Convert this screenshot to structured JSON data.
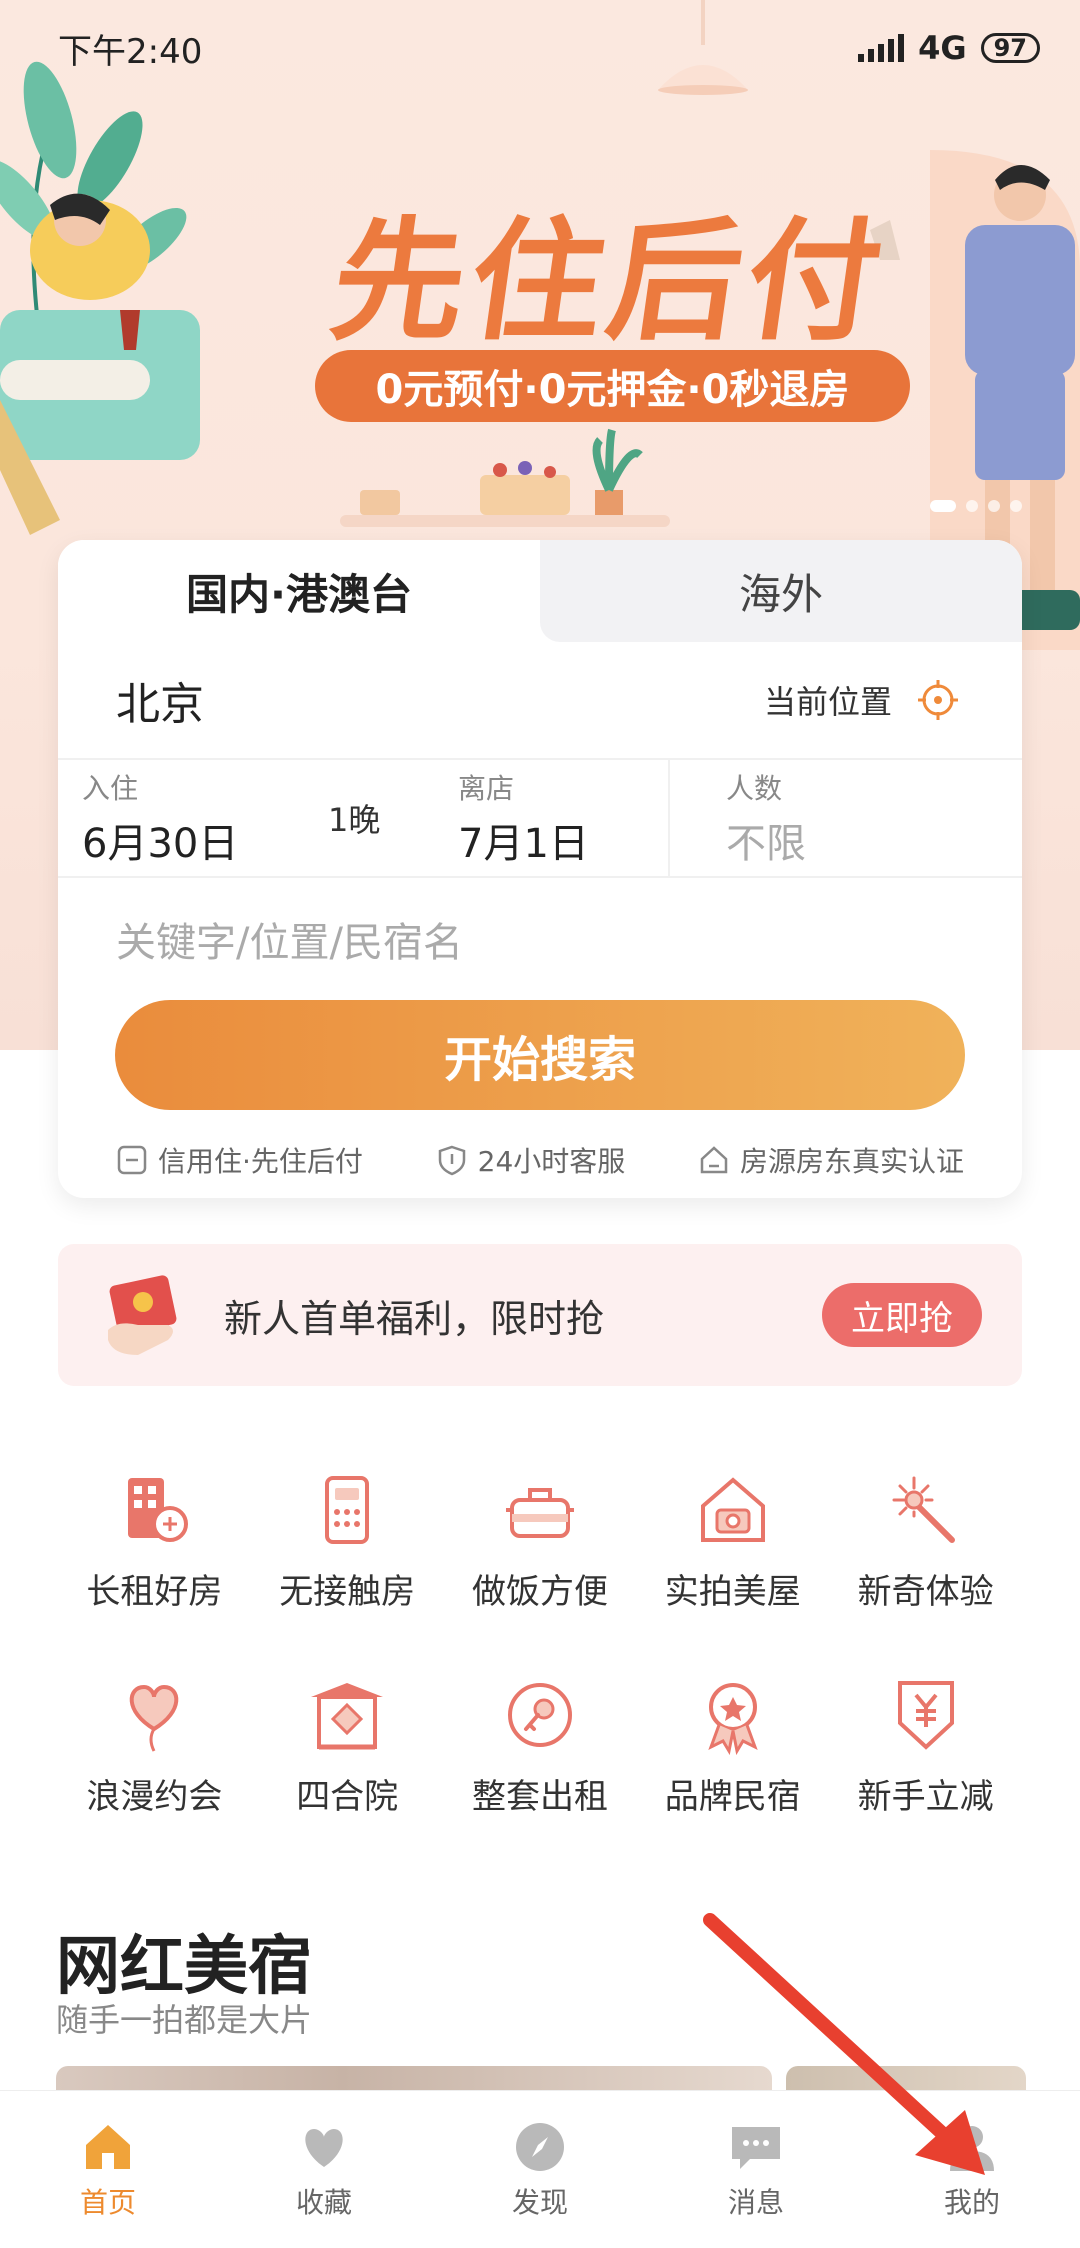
{
  "status_bar": {
    "time": "下午2:40",
    "network": "4G",
    "battery": "97"
  },
  "banner": {
    "title": "先住后付",
    "subtitle": "0元预付·0元押金·0秒退房"
  },
  "search": {
    "tabs": [
      "国内·港澳台",
      "海外"
    ],
    "city": "北京",
    "locate_label": "当前位置",
    "checkin_label": "入住",
    "checkin_date": "6月30日",
    "nights": "1晚",
    "checkout_label": "离店",
    "checkout_date": "7月1日",
    "people_label": "人数",
    "people_value": "不限",
    "keyword_placeholder": "关键字/位置/民宿名",
    "button": "开始搜索",
    "features": [
      "信用住·先住后付",
      "24小时客服",
      "房源房东真实认证"
    ]
  },
  "promo": {
    "text": "新人首单福利，限时抢",
    "button": "立即抢"
  },
  "categories": [
    {
      "label": "长租好房",
      "icon": "building-rent-icon"
    },
    {
      "label": "无接触房",
      "icon": "keypad-door-icon"
    },
    {
      "label": "做饭方便",
      "icon": "cooking-pot-icon"
    },
    {
      "label": "实拍美屋",
      "icon": "house-camera-icon"
    },
    {
      "label": "新奇体验",
      "icon": "magic-wand-icon"
    },
    {
      "label": "浪漫约会",
      "icon": "heart-balloon-icon"
    },
    {
      "label": "四合院",
      "icon": "courtyard-gate-icon"
    },
    {
      "label": "整套出租",
      "icon": "key-circle-icon"
    },
    {
      "label": "品牌民宿",
      "icon": "award-badge-icon"
    },
    {
      "label": "新手立减",
      "icon": "yen-coupon-icon"
    }
  ],
  "section": {
    "title": "网红美宿",
    "subtitle": "随手一拍都是大片"
  },
  "nav": [
    {
      "label": "首页",
      "icon": "home-icon"
    },
    {
      "label": "收藏",
      "icon": "heart-icon"
    },
    {
      "label": "发现",
      "icon": "compass-icon"
    },
    {
      "label": "消息",
      "icon": "message-icon"
    },
    {
      "label": "我的",
      "icon": "user-icon"
    }
  ],
  "colors": {
    "accent": "#ed8a2e",
    "promo": "#ec6d6a",
    "icon": "#e8766a"
  }
}
